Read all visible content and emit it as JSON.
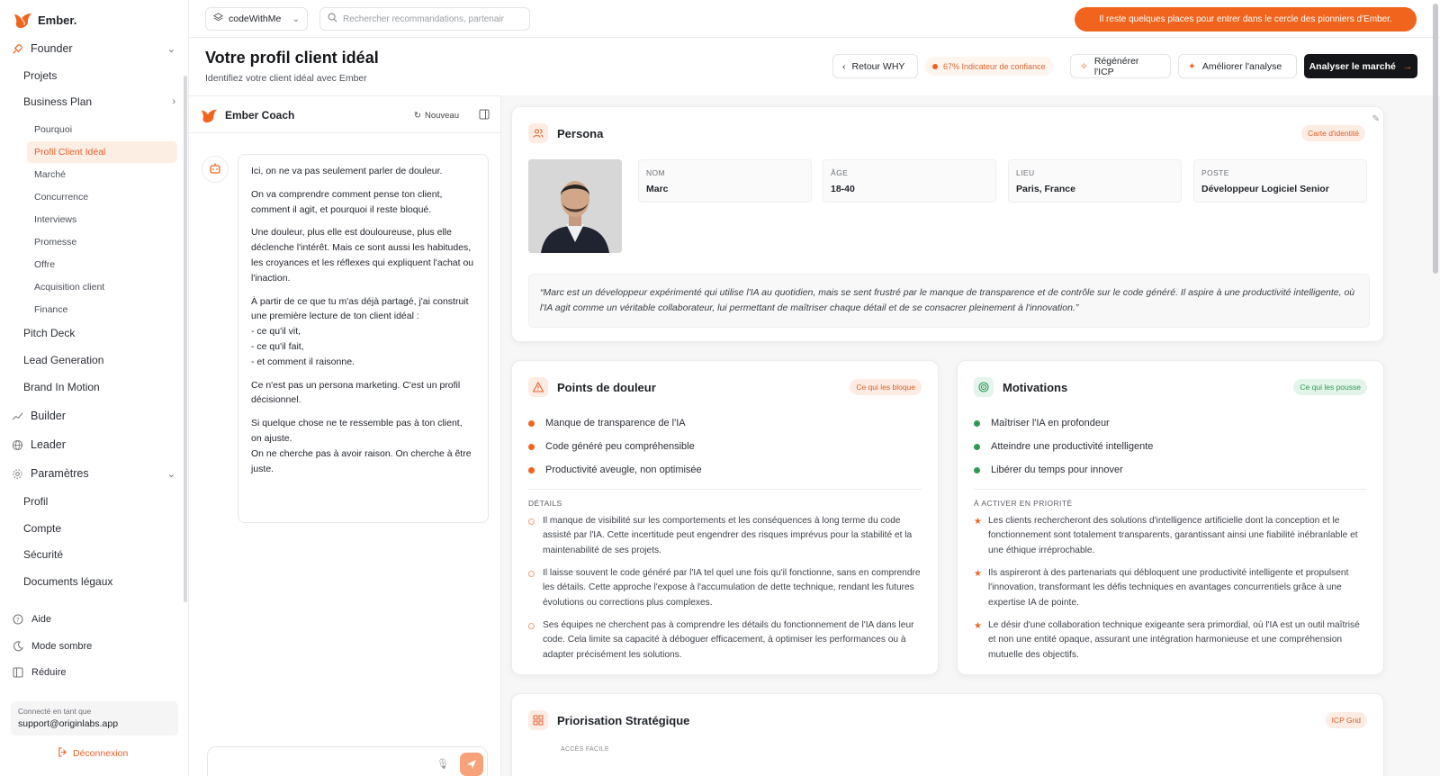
{
  "app": {
    "brand": "Ember."
  },
  "sidebar": {
    "founder": "Founder",
    "projects": "Projets",
    "business_plan": "Business Plan",
    "bp_items": [
      "Pourquoi",
      "Profil Client Idéal",
      "Marché",
      "Concurrence",
      "Interviews",
      "Promesse",
      "Offre",
      "Acquisition client",
      "Finance"
    ],
    "pitch_deck": "Pitch Deck",
    "lead_generation": "Lead Generation",
    "brand_in_motion": "Brand In Motion",
    "builder": "Builder",
    "leader": "Leader",
    "parametres": "Paramètres",
    "param_items": [
      "Profil",
      "Compte",
      "Sécurité",
      "Documents légaux"
    ],
    "aide": "Aide",
    "dark_mode": "Mode sombre",
    "reduce": "Réduire",
    "logged_as_label": "Connecté en tant que",
    "logged_as_email": "support@originlabs.app",
    "logout": "Déconnexion"
  },
  "topbar": {
    "workspace": "codeWithMe",
    "search_placeholder": "Rechercher recommandations, partenair",
    "promo": "Il reste quelques places pour entrer dans le cercle des pionniers d'Ember."
  },
  "header": {
    "title": "Votre profil client idéal",
    "subtitle": "Identifiez votre client idéal avec Ember",
    "back": "Retour WHY",
    "confidence": "67% Indicateur de confiance",
    "regen": "Régénérer l'ICP",
    "improve": "Améliorer l'analyse",
    "analyze": "Analyser le marché"
  },
  "coach": {
    "title": "Ember Coach",
    "new": "Nouveau",
    "message": [
      "Ici, on ne va pas seulement parler de douleur.",
      "On va comprendre comment pense ton client, comment il agit, et pourquoi il reste bloqué.",
      "Une douleur, plus elle est douloureuse, plus elle déclenche l'intérêt. Mais ce sont aussi les habitudes, les croyances et les réflexes qui expliquent l'achat ou l'inaction.",
      "À partir de ce que tu m'as déjà partagé, j'ai construit une première lecture de ton client idéal :\n- ce qu'il vit,\n- ce qu'il fait,\n- et comment il raisonne.",
      "Ce n'est pas un persona marketing. C'est un profil décisionnel.",
      "Si quelque chose ne te ressemble pas à ton client, on ajuste.\nOn ne cherche pas à avoir raison. On cherche à être juste."
    ]
  },
  "persona": {
    "title": "Persona",
    "badge": "Carte d'identité",
    "fields": [
      {
        "k": "NOM",
        "v": "Marc"
      },
      {
        "k": "ÂGE",
        "v": "18-40"
      },
      {
        "k": "LIEU",
        "v": "Paris, France"
      },
      {
        "k": "POSTE",
        "v": "Développeur Logiciel Senior"
      }
    ],
    "quote": "“Marc est un développeur expérimenté qui utilise l'IA au quotidien, mais se sent frustré par le manque de transparence et de contrôle sur le code généré. Il aspire à une productivité intelligente, où l'IA agit comme un véritable collaborateur, lui permettant de maîtriser chaque détail et de se consacrer pleinement à l'innovation.”"
  },
  "pains": {
    "title": "Points de douleur",
    "badge": "Ce qui les bloque",
    "items": [
      "Manque de transparence de l'IA",
      "Code généré peu compréhensible",
      "Productivité aveugle, non optimisée"
    ],
    "details_label": "DÉTAILS",
    "details": [
      "Il manque de visibilité sur les comportements et les conséquences à long terme du code assisté par l'IA. Cette incertitude peut engendrer des risques imprévus pour la stabilité et la maintenabilité de ses projets.",
      "Il laisse souvent le code généré par l'IA tel quel une fois qu'il fonctionne, sans en comprendre les détails. Cette approche l'expose à l'accumulation de dette technique, rendant les futures évolutions ou corrections plus complexes.",
      "Ses équipes ne cherchent pas à comprendre les détails du fonctionnement de l'IA dans leur code. Cela limite sa capacité à déboguer efficacement, à optimiser les performances ou à adapter précisément les solutions."
    ]
  },
  "motivations": {
    "title": "Motivations",
    "badge": "Ce qui les pousse",
    "items": [
      "Maîtriser l'IA en profondeur",
      "Atteindre une productivité intelligente",
      "Libérer du temps pour innover"
    ],
    "details_label": "À ACTIVER EN PRIORITÉ",
    "details": [
      "Les clients rechercheront des solutions d'intelligence artificielle dont la conception et le fonctionnement sont totalement transparents, garantissant ainsi une fiabilité inébranlable et une éthique irréprochable.",
      "Ils aspireront à des partenariats qui débloquent une productivité intelligente et propulsent l'innovation, transformant les défis techniques en avantages concurrentiels grâce à une expertise IA de pointe.",
      "Le désir d'une collaboration technique exigeante sera primordial, où l'IA est un outil maîtrisé et non une entité opaque, assurant une intégration harmonieuse et une compréhension mutuelle des objectifs."
    ]
  },
  "priorisation": {
    "title": "Priorisation Stratégique",
    "badge": "ICP Grid",
    "sub": "ACCÈS FACILE"
  },
  "colors": {
    "accent": "#f0641e",
    "green": "#2f9a57",
    "dark": "#141619"
  }
}
